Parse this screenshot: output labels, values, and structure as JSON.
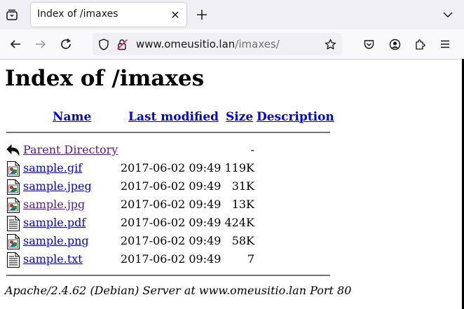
{
  "browser": {
    "tab_title": "Index of /imaxes",
    "url_domain": "www.omeusitio.lan",
    "url_path": "/imaxes/"
  },
  "page": {
    "title": "Index of /imaxes",
    "columns": {
      "name": "Name",
      "last_modified": "Last modified",
      "size": "Size",
      "description": "Description"
    },
    "entries": [
      {
        "name": "Parent Directory",
        "date": "",
        "size": "-",
        "icon": "back-icon",
        "visited": true
      },
      {
        "name": "sample.gif",
        "date": "2017-06-02 09:49",
        "size": "119K",
        "icon": "image-file-icon",
        "visited": false
      },
      {
        "name": "sample.jpeg",
        "date": "2017-06-02 09:49",
        "size": "31K",
        "icon": "image-file-icon",
        "visited": false
      },
      {
        "name": "sample.jpg",
        "date": "2017-06-02 09:49",
        "size": "13K",
        "icon": "image-file-icon",
        "visited": true
      },
      {
        "name": "sample.pdf",
        "date": "2017-06-02 09:49",
        "size": "424K",
        "icon": "document-file-icon",
        "visited": false
      },
      {
        "name": "sample.png",
        "date": "2017-06-02 09:49",
        "size": "58K",
        "icon": "image-file-icon",
        "visited": false
      },
      {
        "name": "sample.txt",
        "date": "2017-06-02 09:49",
        "size": "7",
        "icon": "text-file-icon",
        "visited": false
      }
    ],
    "footer": "Apache/2.4.62 (Debian) Server at www.omeusitio.lan Port 80"
  },
  "colors": {
    "link": "#0000ee",
    "visited_link": "#551a8b",
    "tabbar_bg": "#f0f0f4",
    "navbar_bg": "#f9f9fb"
  }
}
